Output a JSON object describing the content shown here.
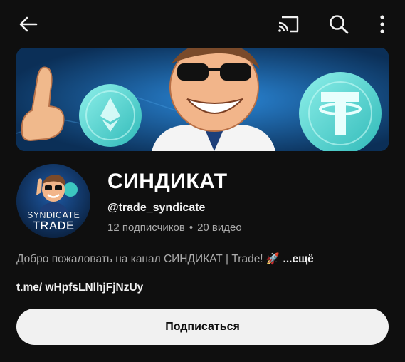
{
  "toolbar": {
    "back_icon": "arrow-left-icon",
    "cast_icon": "cast-icon",
    "search_icon": "search-icon",
    "more_icon": "more-vertical-icon"
  },
  "channel": {
    "name": "СИНДИКАТ",
    "handle": "@trade_syndicate",
    "subscribers": "12 подписчиков",
    "separator": "•",
    "videos": "20 видео",
    "description": "Добро пожаловать на канал СИНДИКАТ | Trade! 🚀",
    "description_more": "...ещё",
    "link": "t.me/ wHpfsLNlhjFjNzUy",
    "avatar_text_1": "SYNDICATE",
    "avatar_text_2": "TRADE"
  },
  "actions": {
    "subscribe_label": "Подписаться"
  },
  "colors": {
    "background": "#0f0f0f",
    "text_primary": "#f1f1f1",
    "text_secondary": "#aaaaaa",
    "button_bg": "#f1f1f1"
  }
}
